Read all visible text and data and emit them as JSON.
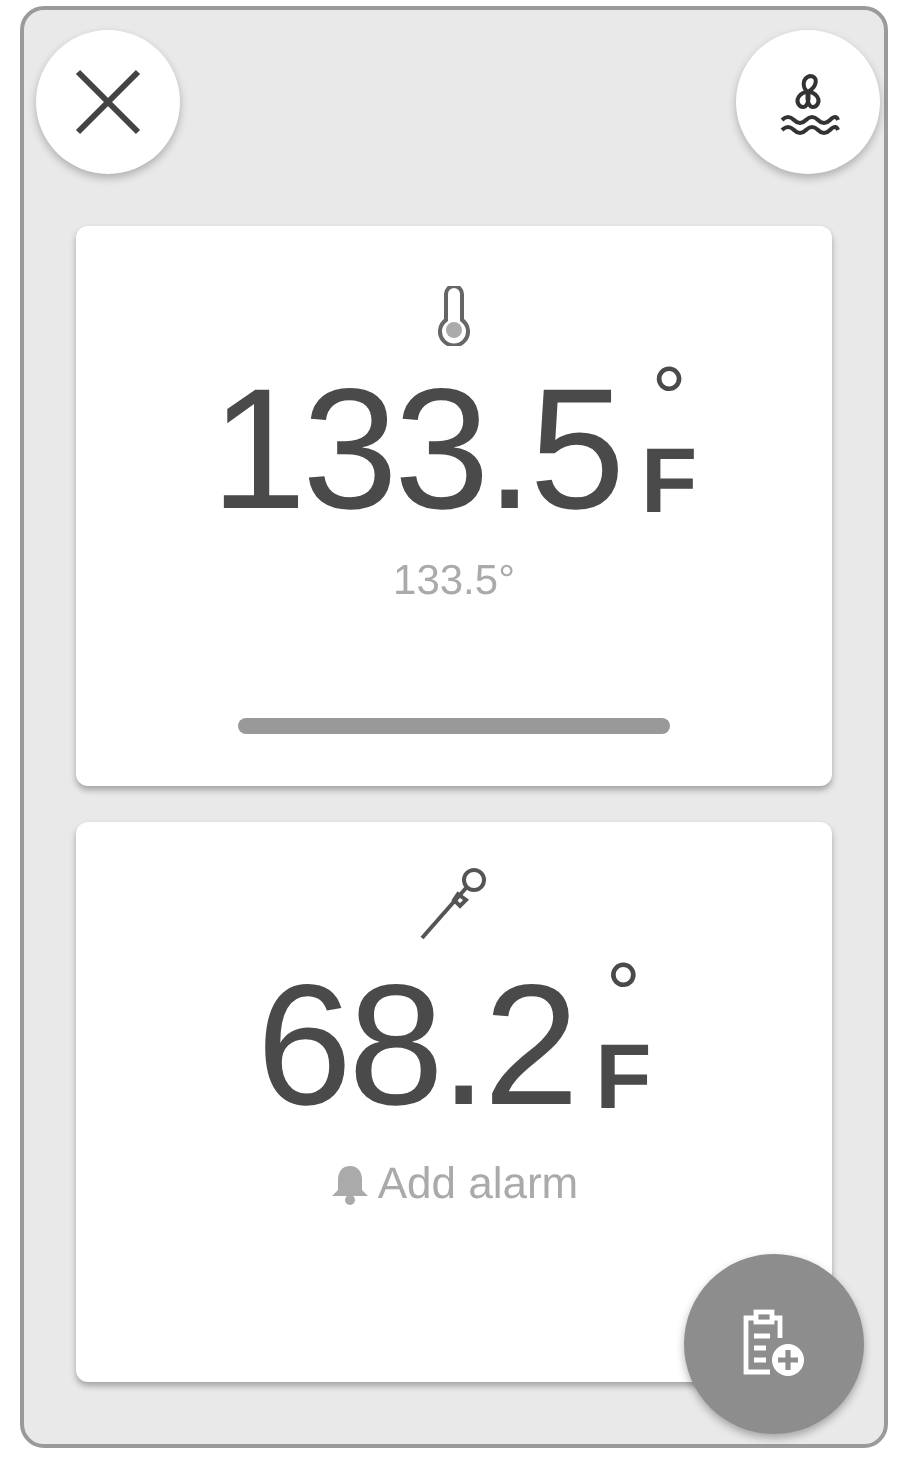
{
  "cards": [
    {
      "kind": "oven",
      "value": "133.5",
      "degree": "°",
      "unit": "F",
      "secondary": "133.5°"
    },
    {
      "kind": "probe",
      "value": "68.2",
      "degree": "°",
      "unit": "F",
      "alarm_link": "Add alarm"
    }
  ]
}
